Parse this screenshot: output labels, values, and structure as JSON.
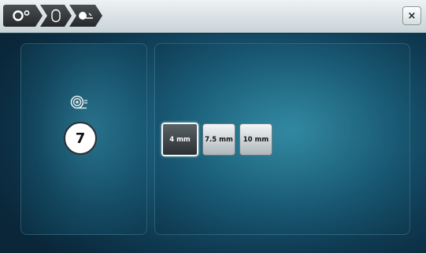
{
  "titlebar": {
    "breadcrumbs": [
      {
        "icon": "needle-position-icon"
      },
      {
        "icon": "bobbin-icon"
      },
      {
        "icon": "thread-cutter-icon"
      }
    ],
    "close_label": "×"
  },
  "left_panel": {
    "icon": "thread-spool-icon",
    "value": "7"
  },
  "right_panel": {
    "options": [
      {
        "label": "4 mm",
        "selected": true
      },
      {
        "label": "7.5 mm",
        "selected": false
      },
      {
        "label": "10 mm",
        "selected": false
      }
    ]
  },
  "colors": {
    "background": "#1a5a76",
    "titlebar": "#dfe6e9",
    "selected_button": "#3a4043"
  }
}
